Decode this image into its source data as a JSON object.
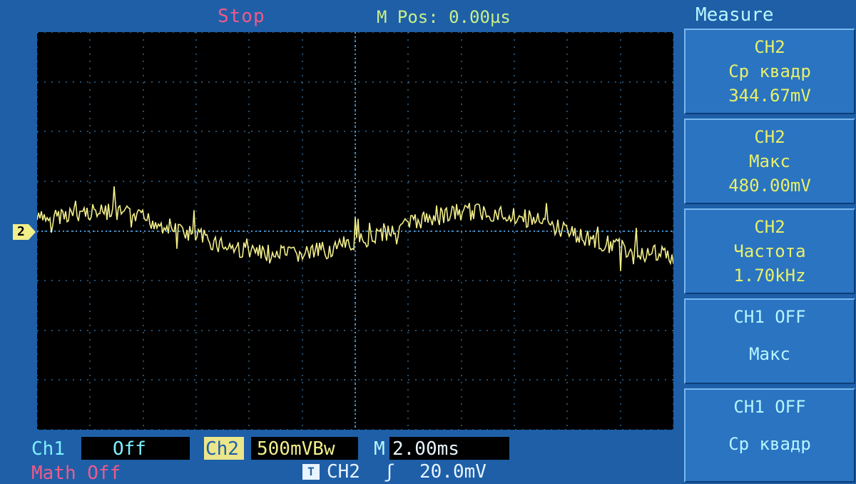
{
  "header": {
    "run_state": "Stop",
    "m_pos": "M Pos: 0.00µs"
  },
  "measure": {
    "title": "Measure",
    "items": [
      {
        "source": "CH2",
        "type": "Ср квадр",
        "value": "344.67mV"
      },
      {
        "source": "CH2",
        "type": "Макс",
        "value": "480.00mV"
      },
      {
        "source": "CH2",
        "type": "Частота",
        "value": "1.70kHz"
      },
      {
        "source": "CH1  OFF",
        "type": "Макс",
        "value": ""
      },
      {
        "source": "CH1  OFF",
        "type": "Ср квадр",
        "value": ""
      }
    ]
  },
  "channel_marker": "2",
  "bottom": {
    "ch1_label": "Ch1",
    "ch1_value": "Off",
    "ch2_label": "Ch2",
    "ch2_scale": "500mVBw",
    "m_label": "M",
    "timebase": "2.00ms",
    "math": "Math Off",
    "trigger_icon": "T",
    "trigger_source": "CH2",
    "trigger_edge_icon": "rising-edge-icon",
    "trigger_edge_glyph": "ʃ",
    "trigger_level": "20.0mV"
  },
  "colors": {
    "background": "#1e5fa8",
    "screen": "#000000",
    "trace": "#f2ee8a",
    "grid": "#4a9ad8",
    "stop": "#f05a8a"
  }
}
